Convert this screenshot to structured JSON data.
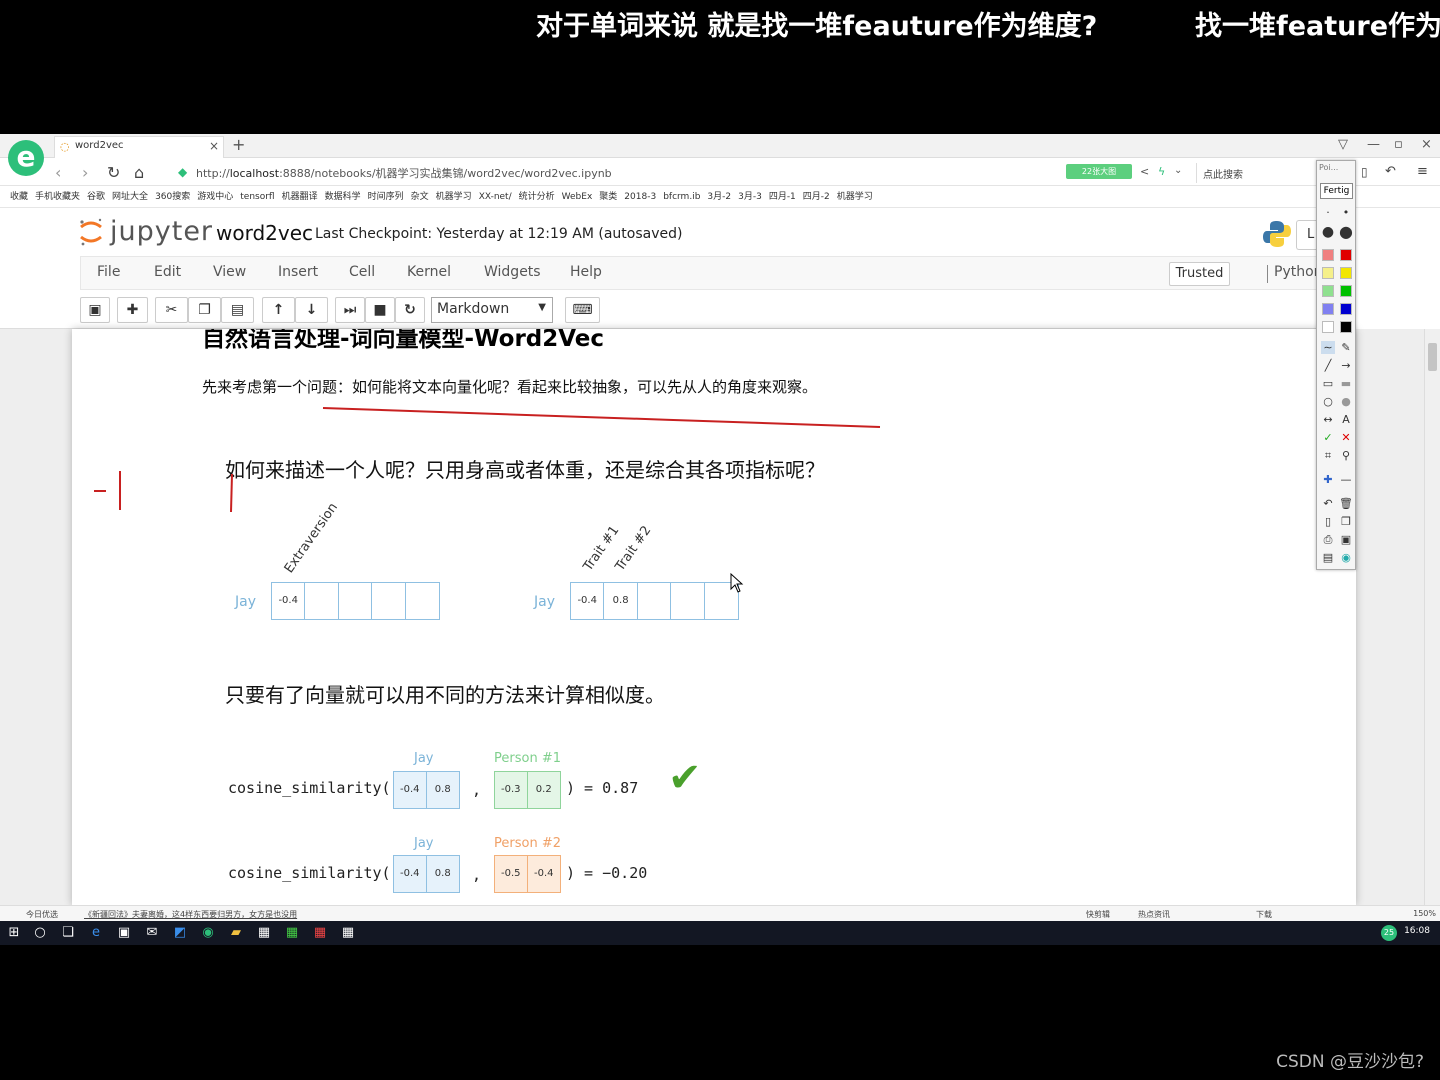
{
  "subtitles": {
    "line1": "对于单词来说 就是找一堆feauture作为维度?",
    "line2": "找一堆feature作为"
  },
  "browser": {
    "tab_title": "word2vec",
    "new_tab": "+",
    "url_prefix": "http://",
    "url_host": "localhost",
    "url_path": ":8888/notebooks/机器学习实战集锦/word2vec/word2vec.ipynb",
    "addon_badge": "22张大图",
    "search_placeholder": "点此搜索",
    "bookmarks": [
      "收藏",
      "手机收藏夹",
      "谷歌",
      "网址大全",
      "360搜索",
      "游戏中心",
      "tensorfl",
      "机器翻译",
      "数据科学",
      "时间序列",
      "杂文",
      "机器学习",
      "XX-net/",
      "统计分析",
      "WebEx",
      "聚类",
      "2018-3",
      "bfcrm.ib",
      "3月-2",
      "3月-3",
      "四月-1",
      "四月-2",
      "机器学习"
    ]
  },
  "jupyter": {
    "logo_text": "jupyter",
    "notebook_name": "word2vec",
    "checkpoint": "Last Checkpoint: Yesterday at 12:19 AM (autosaved)",
    "logout_label": "L",
    "menu": [
      "File",
      "Edit",
      "View",
      "Insert",
      "Cell",
      "Kernel",
      "Widgets",
      "Help"
    ],
    "trusted": "Trusted",
    "kernel": "Python",
    "cell_type": "Markdown"
  },
  "notebook": {
    "heading": "自然语言处理-词向量模型-Word2Vec",
    "intro": "先来考虑第一个问题：如何能将文本向量化呢？看起来比较抽象，可以先从人的角度来观察。",
    "question": "如何来描述一个人呢？只用身高或者体重，还是综合其各项指标呢？",
    "vector1": {
      "label": "Jay",
      "trait": "Extraversion",
      "values": [
        "-0.4",
        "",
        "",
        "",
        ""
      ]
    },
    "vector2": {
      "label": "Jay",
      "traits": [
        "Trait #1",
        "Trait #2"
      ],
      "values": [
        "-0.4",
        "0.8",
        "",
        "",
        ""
      ]
    },
    "similarity_text": "只要有了向量就可以用不同的方法来计算相似度。",
    "cosine": [
      {
        "func": "cosine_similarity(",
        "a_label": "Jay",
        "a": [
          "-0.4",
          "0.8"
        ],
        "comma": ",",
        "b_label": "Person #1",
        "b": [
          "-0.3",
          "0.2"
        ],
        "result": ") = 0.87",
        "check": "✔"
      },
      {
        "func": "cosine_similarity(",
        "a_label": "Jay",
        "a": [
          "-0.4",
          "0.8"
        ],
        "comma": ",",
        "b_label": "Person #2",
        "b": [
          "-0.5",
          "-0.4"
        ],
        "result": ") = −0.20"
      }
    ]
  },
  "palette": {
    "header": "Poi...",
    "done": "Fertig",
    "colors": [
      "#f08080",
      "#e00000",
      "#f5f08a",
      "#f2e600",
      "#8fe08f",
      "#00c000",
      "#8080f0",
      "#0000d0",
      "#ffffff",
      "#000000"
    ]
  },
  "status": {
    "news_label": "今日优选",
    "headline": "《新疆回法》夫妻离婚，这4样东西要归男方，女方是也没用",
    "right_items": [
      "快剪辑",
      "热点资讯",
      "下载"
    ],
    "zoom": "150%"
  },
  "taskbar": {
    "time": "16:08",
    "badge": "25"
  },
  "watermark": "CSDN @豆沙沙包?"
}
